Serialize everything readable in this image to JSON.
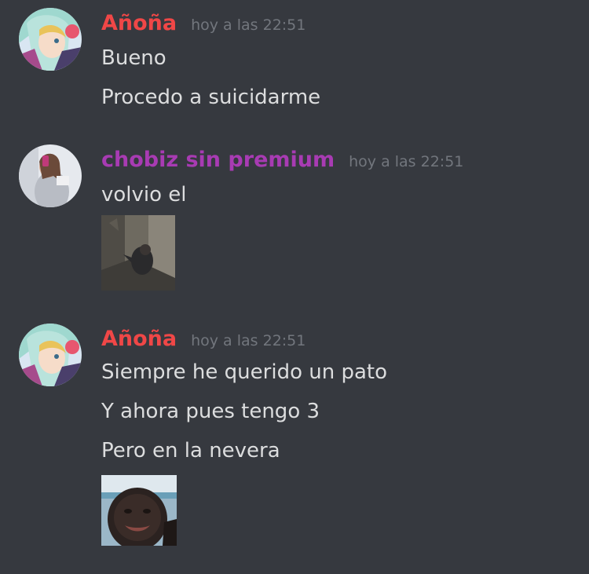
{
  "messages": [
    {
      "author": "Añoña",
      "author_color": "#f04747",
      "timestamp": "hoy a las 22:51",
      "lines": [
        "Bueno",
        "Procedo a suicidarme"
      ]
    },
    {
      "author": "chobiz sin premium",
      "author_color": "#a83bb3",
      "timestamp": "hoy a las 22:51",
      "lines": [
        "volvio el"
      ]
    },
    {
      "author": "Añoña",
      "author_color": "#f04747",
      "timestamp": "hoy a las 22:51",
      "lines": [
        "Siempre he querido un pato",
        "Y ahora pues tengo 3",
        "Pero en la nevera"
      ]
    }
  ],
  "colors": {
    "background": "#36393f",
    "text": "#dcddde",
    "timestamp": "#72767d"
  }
}
